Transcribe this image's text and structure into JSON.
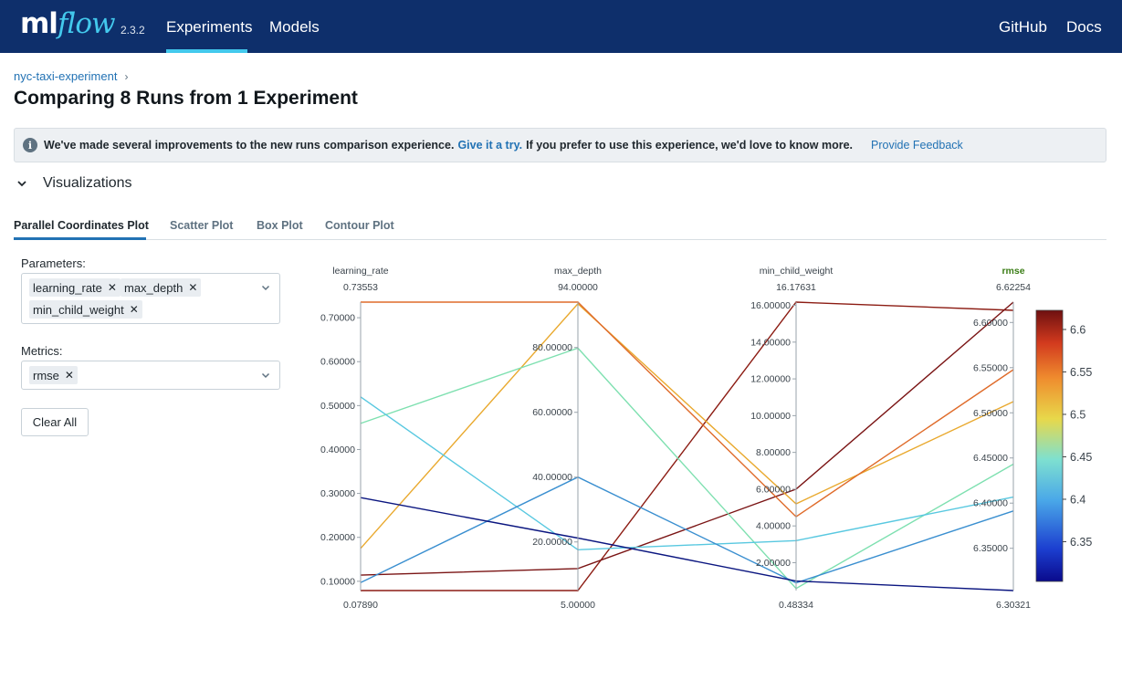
{
  "app": {
    "logo_ml": "ml",
    "logo_flow": "flow",
    "version": "2.3.2"
  },
  "nav": {
    "experiments": "Experiments",
    "models": "Models",
    "github": "GitHub",
    "docs": "Docs"
  },
  "breadcrumb": {
    "experiment": "nyc-taxi-experiment",
    "separator": "›"
  },
  "page_title": "Comparing 8 Runs from 1 Experiment",
  "banner": {
    "text1": "We've made several improvements to the new runs comparison experience.",
    "link": "Give it a try.",
    "text2": "If you prefer to use this experience, we'd love to know more.",
    "feedback": "Provide Feedback",
    "icon": "info-icon"
  },
  "visualizations": {
    "title": "Visualizations",
    "icon": "chevron-down-icon"
  },
  "tabs": [
    {
      "label": "Parallel Coordinates Plot",
      "active": true
    },
    {
      "label": "Scatter Plot",
      "active": false
    },
    {
      "label": "Box Plot",
      "active": false
    },
    {
      "label": "Contour Plot",
      "active": false
    }
  ],
  "controls": {
    "parameters_label": "Parameters:",
    "parameters": [
      "learning_rate",
      "max_depth",
      "min_child_weight"
    ],
    "metrics_label": "Metrics:",
    "metrics": [
      "rmse"
    ],
    "clear_all": "Clear All",
    "remove_icon": "close-icon",
    "dropdown_icon": "chevron-down-icon"
  },
  "colors": {
    "nav_bg": "#0e2f6b",
    "accent": "#43c9ed",
    "link": "#2272b4",
    "metric_label": "#3b7d16"
  },
  "chart_data": {
    "type": "parallel_coordinates",
    "axes": [
      {
        "name": "learning_rate",
        "range": [
          0.0789,
          0.73553
        ],
        "top_label": "0.73553",
        "bottom_label": "0.07890",
        "ticks": [
          0.1,
          0.2,
          0.3,
          0.4,
          0.5,
          0.6,
          0.7
        ],
        "tick_labels": [
          "0.10000",
          "0.20000",
          "0.30000",
          "0.40000",
          "0.50000",
          "0.60000",
          "0.70000"
        ]
      },
      {
        "name": "max_depth",
        "range": [
          5,
          94
        ],
        "top_label": "94.00000",
        "bottom_label": "5.00000",
        "ticks": [
          20,
          40,
          60,
          80
        ],
        "tick_labels": [
          "20.00000",
          "40.00000",
          "60.00000",
          "80.00000"
        ]
      },
      {
        "name": "min_child_weight",
        "range": [
          0.48334,
          16.17631
        ],
        "top_label": "16.17631",
        "bottom_label": "0.48334",
        "ticks": [
          2,
          4,
          6,
          8,
          10,
          12,
          14,
          16
        ],
        "tick_labels": [
          "2.00000",
          "4.00000",
          "6.00000",
          "8.00000",
          "10.00000",
          "12.00000",
          "14.00000",
          "16.00000"
        ]
      },
      {
        "name": "rmse",
        "range": [
          6.30321,
          6.62254
        ],
        "top_label": "6.62254",
        "bottom_label": "6.30321",
        "ticks": [
          6.35,
          6.4,
          6.45,
          6.5,
          6.55,
          6.6
        ],
        "tick_labels": [
          "6.35000",
          "6.40000",
          "6.45000",
          "6.50000",
          "6.55000",
          "6.60000"
        ],
        "is_metric": true
      }
    ],
    "runs": [
      {
        "values": [
          0.0789,
          5,
          16.17631,
          6.6134
        ],
        "color": "#8c1c13"
      },
      {
        "values": [
          0.1141,
          11.8,
          6.0,
          6.62254
        ],
        "color": "#7a1414"
      },
      {
        "values": [
          0.1748,
          93.5,
          5.2,
          6.5124
        ],
        "color": "#e9a92e"
      },
      {
        "values": [
          0.73553,
          94,
          4.5,
          6.5478
        ],
        "color": "#df6b2a"
      },
      {
        "values": [
          0.4593,
          79.8,
          0.6,
          6.4432
        ],
        "color": "#7ee0b0"
      },
      {
        "values": [
          0.5198,
          17.6,
          3.2,
          6.4067
        ],
        "color": "#58c8e0"
      },
      {
        "values": [
          0.097,
          40.0,
          0.9,
          6.3913
        ],
        "color": "#3a8fd0"
      },
      {
        "values": [
          0.2904,
          21.2,
          1.0,
          6.30321
        ],
        "color": "#0b1680"
      }
    ],
    "colorbar": {
      "range": [
        6.30321,
        6.62254
      ],
      "ticks": [
        6.35,
        6.4,
        6.45,
        6.5,
        6.55,
        6.6
      ],
      "tick_labels": [
        "6.35",
        "6.4",
        "6.45",
        "6.5",
        "6.55",
        "6.6"
      ]
    }
  }
}
